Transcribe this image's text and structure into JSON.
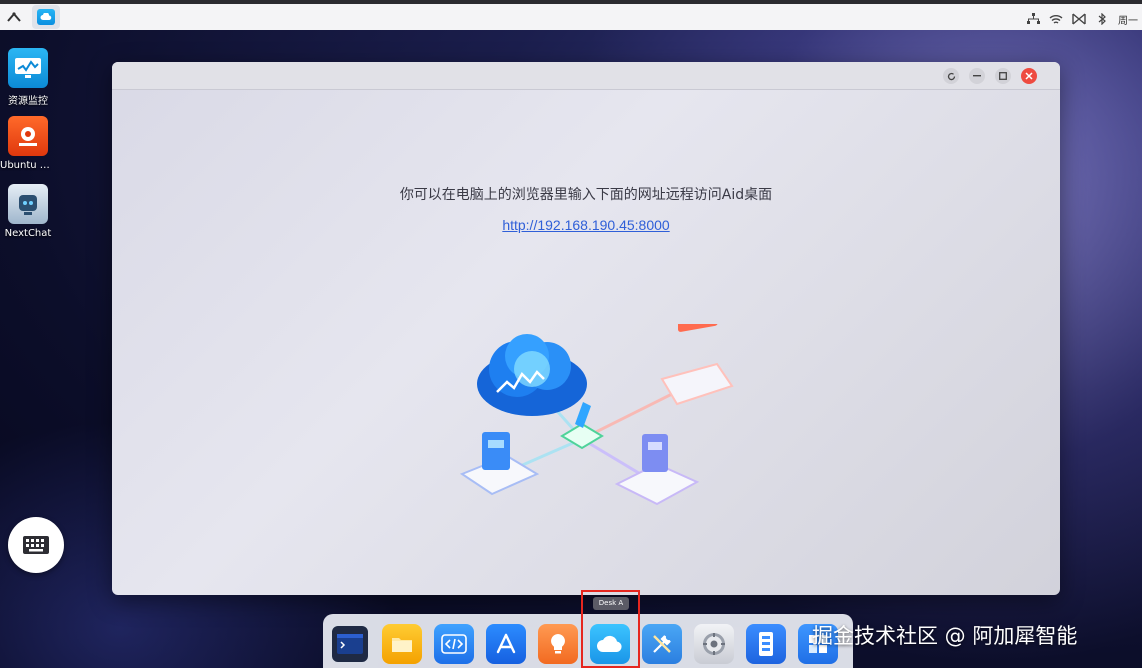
{
  "taskbar": {
    "launcher_icon": "chevron-up-icon",
    "active_app_icon": "cloud-icon",
    "tray": {
      "icons": [
        "network-icon",
        "wifi-icon",
        "antenna-icon",
        "bluetooth-icon"
      ],
      "clock_text": "周一"
    }
  },
  "desktop": {
    "icons": [
      {
        "label": "资源监控",
        "icon": "monitor-chart-icon"
      },
      {
        "label": "Ubuntu Des…",
        "icon": "ubuntu-desktop-icon"
      },
      {
        "label": "NextChat",
        "icon": "chat-bot-icon"
      }
    ],
    "keyboard_button_icon": "keyboard-icon"
  },
  "window": {
    "controls": [
      "refresh-icon",
      "minimize-icon",
      "maximize-icon",
      "close-icon"
    ],
    "message": "你可以在电脑上的浏览器里输入下面的网址远程访问Aid桌面",
    "url": "http://192.168.190.45:8000",
    "illustration": "cloud-device-network-illustration"
  },
  "dock": {
    "items": [
      {
        "name": "terminal",
        "icon": "terminal-icon"
      },
      {
        "name": "files",
        "icon": "folder-icon"
      },
      {
        "name": "code-editor",
        "icon": "code-icon"
      },
      {
        "name": "app-store",
        "icon": "app-store-icon"
      },
      {
        "name": "tips",
        "icon": "lightbulb-icon"
      },
      {
        "name": "cloud-remote",
        "icon": "cloud-icon"
      },
      {
        "name": "tools",
        "icon": "tools-icon"
      },
      {
        "name": "settings",
        "icon": "gear-icon"
      },
      {
        "name": "device-manager",
        "icon": "device-icon"
      },
      {
        "name": "windows-app",
        "icon": "windows-icon"
      }
    ],
    "tooltip": "Desk A",
    "highlight_color": "#e6261f"
  },
  "watermark": "掘金技术社区 @ 阿加犀智能"
}
